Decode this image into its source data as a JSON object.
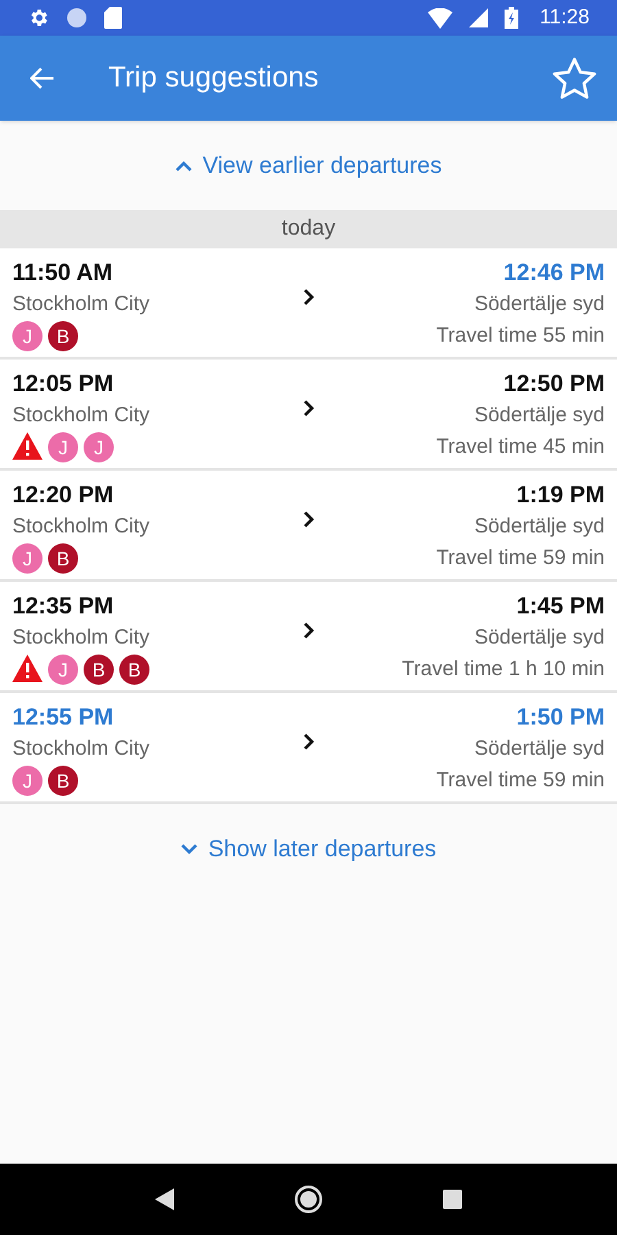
{
  "status_bar": {
    "time": "11:28"
  },
  "app_bar": {
    "title": "Trip suggestions",
    "favorite": false
  },
  "earlier_button": {
    "label": "View earlier departures"
  },
  "day_header": "today",
  "trips": [
    {
      "departure": "11:50 AM",
      "departure_updated": false,
      "from": "Stockholm City",
      "arrival": "12:46 PM",
      "arrival_updated": true,
      "to": "Södertälje syd",
      "travel_time": "Travel time 55 min",
      "legs": [
        {
          "kind": "line",
          "label": "J",
          "color": "#ec6ca9"
        },
        {
          "kind": "line",
          "label": "B",
          "color": "#b0102a"
        }
      ]
    },
    {
      "departure": "12:05 PM",
      "departure_updated": false,
      "from": "Stockholm City",
      "arrival": "12:50 PM",
      "arrival_updated": false,
      "to": "Södertälje syd",
      "travel_time": "Travel time 45 min",
      "legs": [
        {
          "kind": "warning"
        },
        {
          "kind": "line",
          "label": "J",
          "color": "#ec6ca9"
        },
        {
          "kind": "line",
          "label": "J",
          "color": "#ec6ca9"
        }
      ]
    },
    {
      "departure": "12:20 PM",
      "departure_updated": false,
      "from": "Stockholm City",
      "arrival": "1:19 PM",
      "arrival_updated": false,
      "to": "Södertälje syd",
      "travel_time": "Travel time 59 min",
      "legs": [
        {
          "kind": "line",
          "label": "J",
          "color": "#ec6ca9"
        },
        {
          "kind": "line",
          "label": "B",
          "color": "#b0102a"
        }
      ]
    },
    {
      "departure": "12:35 PM",
      "departure_updated": false,
      "from": "Stockholm City",
      "arrival": "1:45 PM",
      "arrival_updated": false,
      "to": "Södertälje syd",
      "travel_time": "Travel time 1 h 10 min",
      "legs": [
        {
          "kind": "warning"
        },
        {
          "kind": "line",
          "label": "J",
          "color": "#ec6ca9"
        },
        {
          "kind": "line",
          "label": "B",
          "color": "#b0102a"
        },
        {
          "kind": "line",
          "label": "B",
          "color": "#b0102a"
        }
      ]
    },
    {
      "departure": "12:55 PM",
      "departure_updated": true,
      "from": "Stockholm City",
      "arrival": "1:50 PM",
      "arrival_updated": true,
      "to": "Södertälje syd",
      "travel_time": "Travel time 59 min",
      "legs": [
        {
          "kind": "line",
          "label": "J",
          "color": "#ec6ca9"
        },
        {
          "kind": "line",
          "label": "B",
          "color": "#b0102a"
        }
      ]
    }
  ],
  "later_button": {
    "label": "Show later departures"
  }
}
